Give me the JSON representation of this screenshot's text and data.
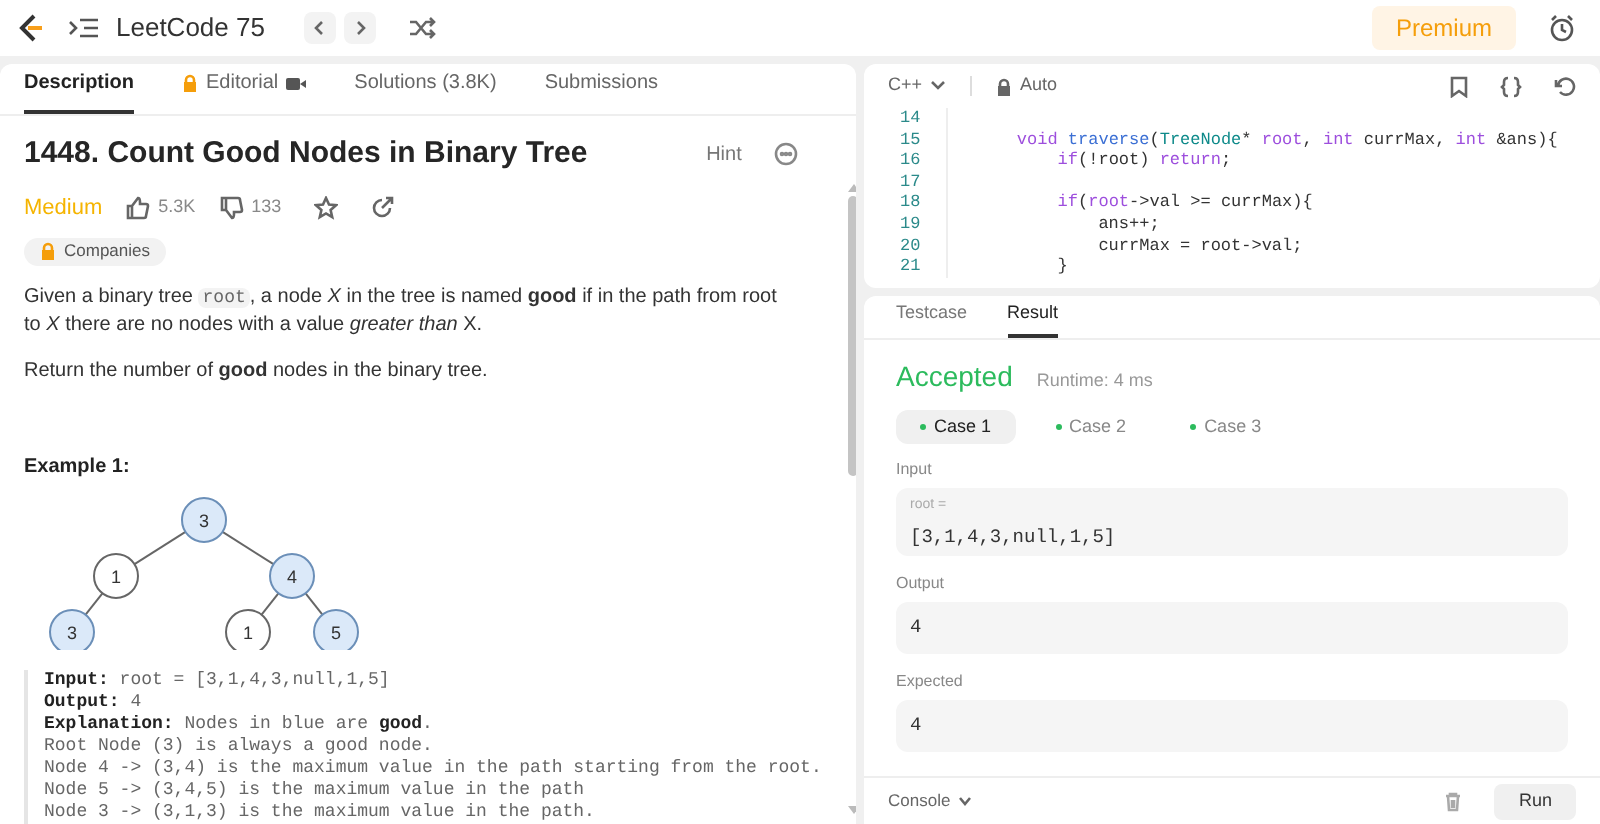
{
  "top_bar": {
    "list_title": "LeetCode 75",
    "premium": "Premium"
  },
  "left_panel": {
    "tabs": [
      {
        "label": "Description",
        "selected": true,
        "kind": "plain"
      },
      {
        "label": "Editorial",
        "selected": false,
        "kind": "locked-video"
      },
      {
        "label": "Solutions (3.8K)",
        "selected": false,
        "kind": "plain"
      },
      {
        "label": "Submissions",
        "selected": false,
        "kind": "plain"
      }
    ],
    "problem": {
      "title": "1448. Count Good Nodes in Binary Tree",
      "hint": "Hint",
      "difficulty": "Medium",
      "likes": "5.3K",
      "dislikes": "133",
      "companies": "Companies",
      "description": [
        {
          "kind": "text",
          "text": "Given a binary tree "
        },
        {
          "kind": "code",
          "text": "root"
        },
        {
          "kind": "text",
          "text": ", a node *X* in the tree is named **good** if in the path from root to *X* there are no nodes with a value *greater than* X."
        }
      ],
      "return_text": "Return the number of **good** nodes in the binary tree.",
      "example_title": "Example 1:",
      "tree": {
        "value": "3",
        "good": true,
        "children": [
          {
            "kind": "left_child",
            "value": "1",
            "good": false,
            "children": [
              {
                "kind": "left_child",
                "value": "3",
                "good": true
              }
            ]
          },
          {
            "kind": "right_child",
            "value": "4",
            "good": true,
            "children": [
              {
                "kind": "left_child",
                "value": "1",
                "good": false
              },
              {
                "kind": "right_child",
                "value": "5",
                "good": true
              }
            ]
          }
        ]
      },
      "example_lines": [
        "**Input:** root = [3,1,4,3,null,1,5]",
        "**Output:** 4",
        "**Explanation:** Nodes in blue are **good**.",
        "Root Node (3) is always a good node.",
        "Node 4 -> (3,4) is the maximum value in the path starting from the root.",
        "Node 5 -> (3,4,5) is the maximum value in the path",
        "Node 3 -> (3,1,3) is the maximum value in the path."
      ]
    }
  },
  "editor": {
    "language": "C++",
    "mode": "Auto",
    "lines": [
      {
        "number": "14"
      },
      {
        "number": "15",
        "tokens": [
          {
            "kind": "keyword",
            "text": "    void"
          },
          {
            "kind": "function",
            "text": " traverse"
          },
          {
            "kind": "plain",
            "text": "("
          },
          {
            "kind": "type",
            "text": "TreeNode"
          },
          {
            "kind": "plain",
            "text": "* "
          },
          {
            "kind": "keyword",
            "text": "root"
          },
          {
            "kind": "plain",
            "text": ", "
          },
          {
            "kind": "keyword",
            "text": "int"
          },
          {
            "kind": "plain",
            "text": " currMax, "
          },
          {
            "kind": "keyword",
            "text": "int"
          },
          {
            "kind": "plain",
            "text": " &ans){"
          }
        ]
      },
      {
        "number": "16",
        "tokens": [
          {
            "kind": "keyword",
            "text": "        if"
          },
          {
            "kind": "plain",
            "text": "(!root) "
          },
          {
            "kind": "keyword",
            "text": "return"
          },
          {
            "kind": "plain",
            "text": ";"
          }
        ]
      },
      {
        "number": "17"
      },
      {
        "number": "18",
        "tokens": [
          {
            "kind": "keyword",
            "text": "        if"
          },
          {
            "kind": "plain",
            "text": "("
          },
          {
            "kind": "keyword",
            "text": "root"
          },
          {
            "kind": "plain",
            "text": "->val >= currMax){"
          }
        ]
      },
      {
        "number": "19",
        "tokens": [
          {
            "kind": "plain",
            "text": "            ans++;"
          }
        ]
      },
      {
        "number": "20",
        "tokens": [
          {
            "kind": "plain",
            "text": "            currMax = root->val;"
          }
        ]
      },
      {
        "number": "21",
        "tokens": [
          {
            "kind": "plain",
            "text": "        }"
          }
        ]
      }
    ]
  },
  "result_panel": {
    "tabs": [
      {
        "label": "Testcase",
        "selected": false
      },
      {
        "label": "Result",
        "selected": true
      }
    ],
    "status": "Accepted",
    "runtime": "Runtime: 4 ms",
    "cases": [
      {
        "label": "Case 1",
        "selected": true
      },
      {
        "label": "Case 2",
        "selected": false
      },
      {
        "label": "Case 3",
        "selected": false
      }
    ],
    "input_label": "Input",
    "input_name": "root =",
    "input_value": "[3,1,4,3,null,1,5]",
    "output_label": "Output",
    "output_value": "4",
    "expected_label": "Expected",
    "expected_value": "4",
    "console": "Console",
    "run": "Run"
  }
}
